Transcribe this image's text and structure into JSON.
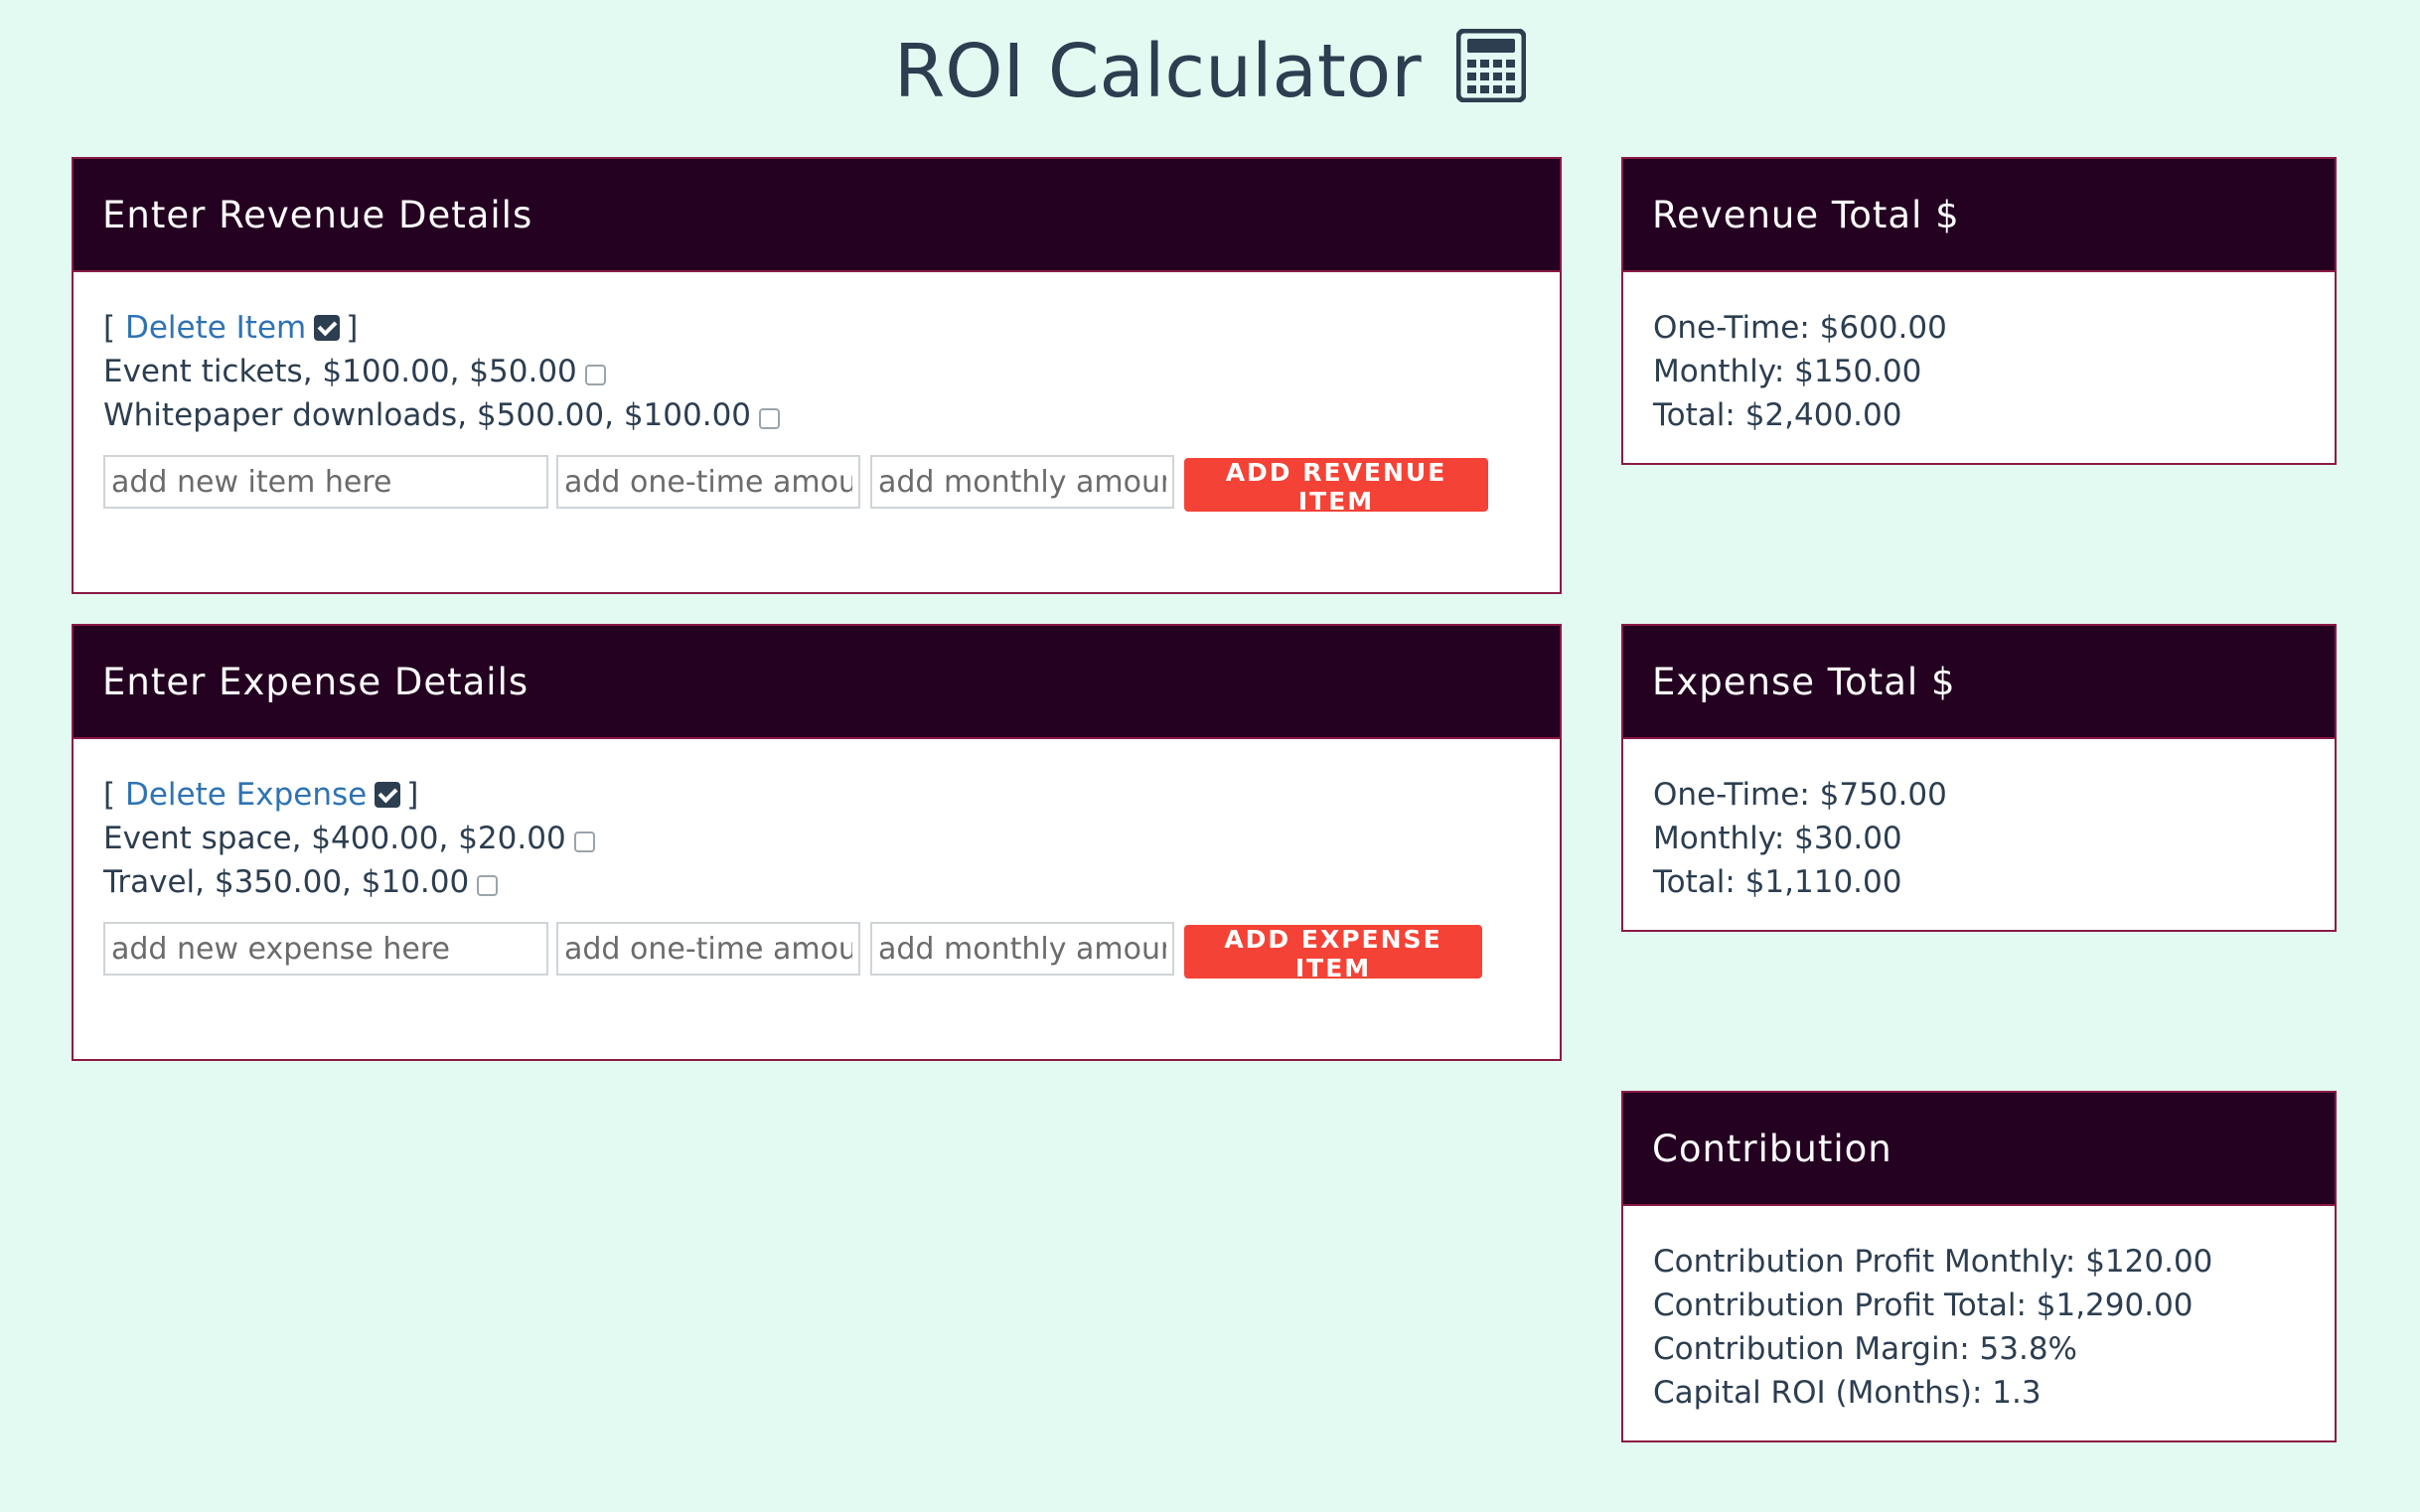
{
  "header": {
    "title": "ROI Calculator",
    "icon": "calculator-icon"
  },
  "revenue_form": {
    "title": "Enter Revenue Details",
    "delete_label": "Delete Item",
    "items": [
      {
        "text": "Event tickets, $100.00, $50.00"
      },
      {
        "text": "Whitepaper downloads, $500.00, $100.00"
      }
    ],
    "name_placeholder": "add new item here",
    "onetime_placeholder": "add one-time amount",
    "monthly_placeholder": "add monthly amount",
    "add_button": "ADD REVENUE ITEM"
  },
  "expense_form": {
    "title": "Enter Expense Details",
    "delete_label": "Delete Expense",
    "items": [
      {
        "text": "Event space, $400.00, $20.00"
      },
      {
        "text": "Travel, $350.00, $10.00"
      }
    ],
    "name_placeholder": "add new expense here",
    "onetime_placeholder": "add one-time amount",
    "monthly_placeholder": "add monthly amount",
    "add_button": "ADD EXPENSE ITEM"
  },
  "revenue_total": {
    "title": "Revenue Total $",
    "one_time": "One-Time: $600.00",
    "monthly": "Monthly: $150.00",
    "total": "Total: $2,400.00"
  },
  "expense_total": {
    "title": "Expense Total $",
    "one_time": "One-Time: $750.00",
    "monthly": "Monthly: $30.00",
    "total": "Total: $1,110.00"
  },
  "contribution": {
    "title": "Contribution",
    "profit_monthly": "Contribution Profit Monthly: $120.00",
    "profit_total": "Contribution Profit Total: $1,290.00",
    "margin": "Contribution Margin: 53.8%",
    "capital_roi": "Capital ROI (Months): 1.3"
  },
  "colors": {
    "background": "#e3faf2",
    "panel_header": "#240021",
    "panel_border": "#8b1a44",
    "button": "#f44336",
    "link": "#2f73b3"
  }
}
